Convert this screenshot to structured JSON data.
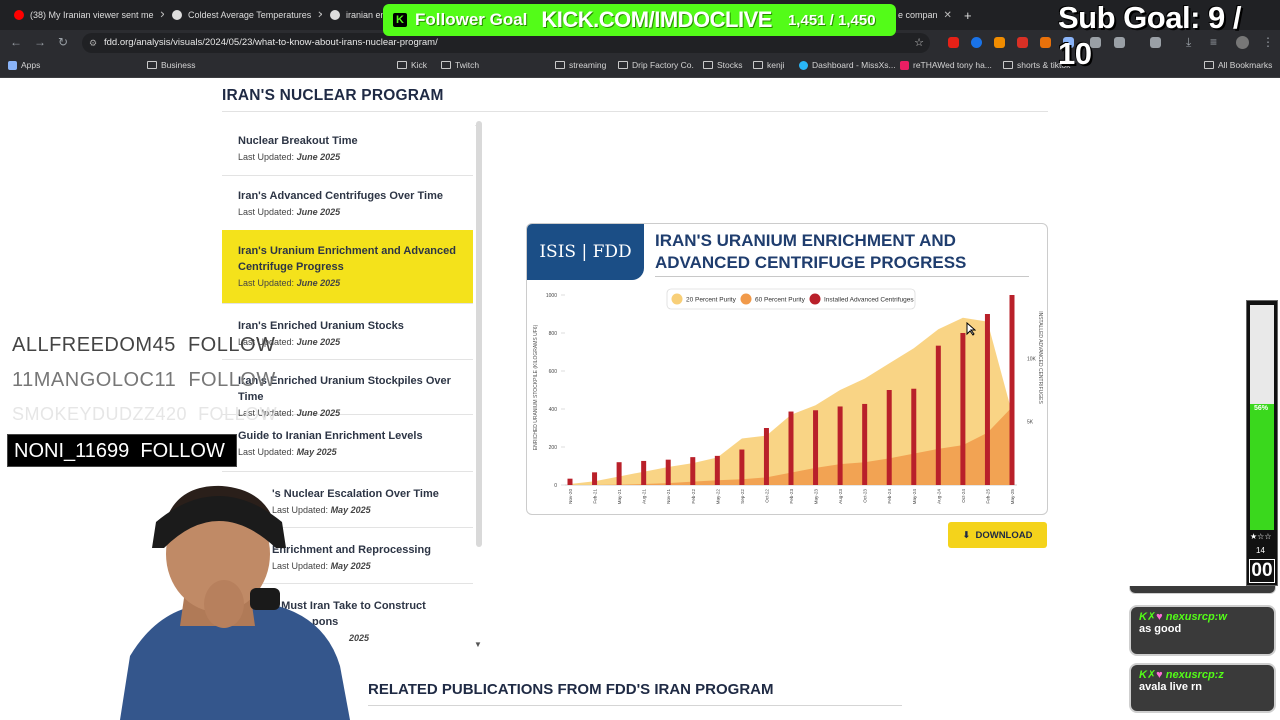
{
  "browser": {
    "tabs": [
      {
        "label": "(38) My Iranian viewer sent me",
        "color": "#ff0000"
      },
      {
        "label": "Coldest Average Temperatures",
        "color": "#dddddd"
      },
      {
        "label": "iranian en",
        "color": "#dddddd"
      },
      {
        "label": "e compan",
        "color": "#dddddd"
      }
    ],
    "url": "fdd.org/analysis/visuals/2024/05/23/what-to-know-about-irans-nuclear-program/",
    "bookmarks": [
      "Apps",
      "Business",
      "Kick",
      "Twitch",
      "streaming",
      "Drip Factory Co.",
      "Stocks",
      "kenji",
      "Dashboard - MissXs...",
      "reTHAWed tony ha...",
      "shorts & tiktok",
      "All Bookmarks"
    ]
  },
  "page": {
    "heading": "IRAN'S NUCLEAR PROGRAM",
    "items": [
      {
        "title": "Nuclear Breakout Time",
        "updated_label": "Last Updated:",
        "updated": "June 2025"
      },
      {
        "title": "Iran's Advanced Centrifuges Over Time",
        "updated_label": "Last Updated:",
        "updated": "June 2025"
      },
      {
        "title": "Iran's Uranium Enrichment and Advanced Centrifuge Progress",
        "updated_label": "Last Updated:",
        "updated": "June 2025"
      },
      {
        "title": "Iran's Enriched Uranium Stocks",
        "updated_label": "Last Updated:",
        "updated": "June 2025"
      },
      {
        "title": "Iran's Enriched Uranium Stockpiles Over Time",
        "updated_label": "Last Updated:",
        "updated": "June 2025"
      },
      {
        "title": "Guide to Iranian Enrichment Levels",
        "updated_label": "Last Updated:",
        "updated": "May 2025"
      },
      {
        "title": "'s Nuclear Escalation Over Time",
        "updated_label": "Last Updated:",
        "updated": "May 2025"
      },
      {
        "title": "Enrichment and Reprocessing",
        "updated_label": "Last Updated:",
        "updated": "May 2025"
      },
      {
        "title": "s Must Iran Take to Construct",
        "title2": "pons",
        "updated_label": "",
        "updated": "2025"
      }
    ],
    "download_label": "DOWNLOAD",
    "related_heading": "RELATED PUBLICATIONS FROM FDD'S IRAN PROGRAM"
  },
  "chart_card": {
    "logo_text": "ISIS | FDD",
    "title": "IRAN'S URANIUM ENRICHMENT AND ADVANCED CENTRIFUGE PROGRESS"
  },
  "chart_data": {
    "type": "area",
    "title": "IRAN'S URANIUM ENRICHMENT AND ADVANCED CENTRIFUGE PROGRESS",
    "ylabel": "ENRICHED URANIUM STOCKPILE (KILOGRAMS UF6)",
    "y2label": "INSTALLED ADVANCED CENTRIFUGES",
    "yticks": [
      "0",
      "200",
      "400",
      "600",
      "800",
      "1000"
    ],
    "y2ticks": [
      "5K",
      "10K"
    ],
    "ylim": [
      0,
      1000
    ],
    "y2lim": [
      0,
      15000
    ],
    "x": [
      "Nov-20",
      "Feb-21",
      "May-21",
      "Aug-21",
      "Nov-21",
      "Feb-22",
      "May-22",
      "Sep-22",
      "Oct-22",
      "Feb-23",
      "May-23",
      "Aug-23",
      "Oct-23",
      "Feb-24",
      "May-24",
      "Aug-24",
      "Oct-24",
      "Feb-25",
      "May-25"
    ],
    "legend": [
      "20 Percent Purity",
      "60 Percent Purity",
      "Installed Advanced Centrifuges"
    ],
    "colors": {
      "p20": "#f8cf78",
      "p60": "#f19a4a",
      "centrifuges": "#b9202a"
    },
    "series": [
      {
        "name": "20 Percent Purity",
        "values": [
          5,
          20,
          45,
          70,
          95,
          115,
          145,
          245,
          260,
          370,
          420,
          500,
          560,
          640,
          720,
          820,
          880,
          860,
          380
        ]
      },
      {
        "name": "60 Percent Purity",
        "values": [
          0,
          0,
          2,
          5,
          10,
          18,
          25,
          30,
          40,
          65,
          90,
          110,
          120,
          140,
          165,
          190,
          210,
          275,
          410
        ]
      },
      {
        "name": "Installed Advanced Centrifuges",
        "values": [
          500,
          1000,
          1800,
          1900,
          2000,
          2200,
          2300,
          2800,
          4500,
          5800,
          5900,
          6200,
          6400,
          7500,
          7600,
          11000,
          12000,
          13500,
          15000
        ]
      }
    ]
  },
  "stream": {
    "follower_goal_label": "Follower Goal",
    "kick_url": "KICK.COM/IMDOCLIVE",
    "follower_count": "1,451 / 1,450",
    "sub_goal": "Sub Goal:  9 / 10",
    "follows": [
      {
        "name": "ALLFREEDOM45",
        "action": "FOLLOW"
      },
      {
        "name": "11MANGOLOC11",
        "action": "FOLLOW"
      },
      {
        "name": "SMOKEYDUDZZ420",
        "action": "FOLLOW"
      },
      {
        "name": "NONI_11699",
        "action": "FOLLOW"
      }
    ],
    "meter_percent": "56%",
    "meter_count": "14",
    "meter_timer": "00",
    "chat": [
      {
        "user": "nexusrcp:w",
        "message": "as good"
      },
      {
        "user": "nexusrcp:z",
        "message": "avala live rn"
      }
    ]
  }
}
